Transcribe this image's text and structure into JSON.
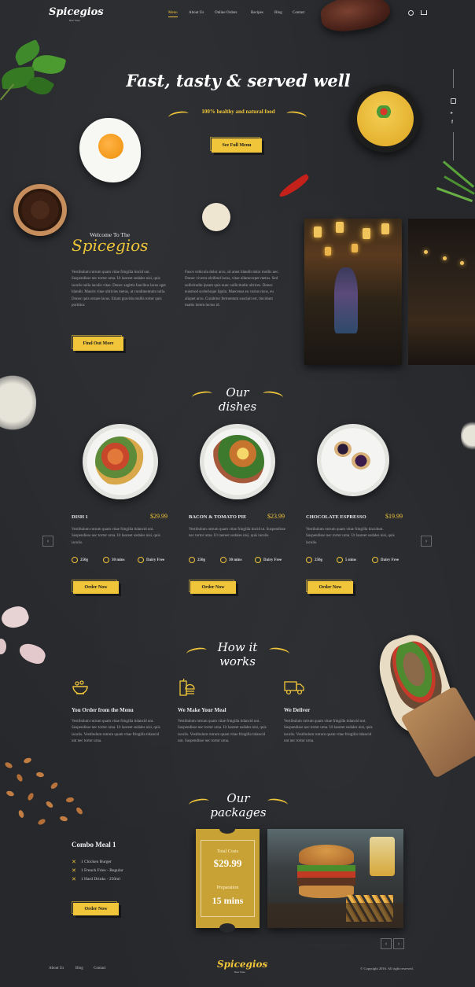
{
  "brand": {
    "logo": "Spicegios",
    "tagline": "Best Taste"
  },
  "nav": {
    "items": [
      {
        "label": "Menu",
        "active": true
      },
      {
        "label": "About Us"
      },
      {
        "label": "Online Orders"
      },
      {
        "label": "Recipes"
      },
      {
        "label": "Blog"
      },
      {
        "label": "Contact"
      }
    ]
  },
  "hero": {
    "title": "Fast, tasty & served well",
    "subtitle": "100% healthy and natural food",
    "cta": "See Full Menu"
  },
  "social": [
    "instagram-icon",
    "twitter-icon",
    "facebook-icon"
  ],
  "welcome": {
    "heading": "Welcome To The",
    "brand": "Spicegios",
    "text_left": "Vestibulum rutrum quam vitae fringilla tincid unt. Suspendisse nec tortor urna. Ut laoreet sodales nisi, quis iaculis nulla iaculis vitae. Donec sagittis faucibus lacus eget blandit. Mauris vitae ultricies metus, at condimentum nulla. Donec quis ornare lacus. Etiam gravida mollis tortor quis porttitor.",
    "text_right": "Fusce vehicula dolor arcu, sit amet blandit dolor mollis nec. Donec viverra eleifend lacus, vitae ullamcorper metus. Sed sollicitudin ipsum quis nunc sollicitudin ultrices. Donec euismod scelerisque ligula. Maecenas eu varius risus, eu aliquet arcu. Curabitur fermentum suscipit est, tincidunt mattis lorem luctus id.",
    "cta": "Find Out More"
  },
  "dishes": {
    "heading": "Our dishes",
    "items": [
      {
        "name": "DISH 1",
        "price": "$29.99",
        "desc": "Vestibulum rutrum quam vitae fringilla tidancid unt. Suspendisse nec tortor urna. Ut laoreet sodales nisi, quis iaculis.",
        "weight": "250g",
        "time": "30 mins",
        "tag": "Dairy Free",
        "cta": "Order Now"
      },
      {
        "name": "BACON & TOMATO PIE",
        "price": "$23.99",
        "desc": "Vestibulum rutrum quam vitae fringilla tincid ut. Suspendisse nec tortor urna. Ut laoreet sodales nisi, quis iaculis.",
        "weight": "250g",
        "time": "30 mins",
        "tag": "Dairy Free",
        "cta": "Order Now"
      },
      {
        "name": "CHOCOLATE ESPRESSO",
        "price": "$19.99",
        "desc": "Vestibulum rutrum quam vitae fringilla tincidunt. Suspendisse nec tortor urna. Ut laoreet sodales nisi, quis iaculis.",
        "weight": "250g",
        "time": "5 mins",
        "tag": "Dairy Free",
        "cta": "Order Now"
      }
    ],
    "prev": "‹",
    "next": "›"
  },
  "how": {
    "heading": "How it works",
    "steps": [
      {
        "title": "You Order from the Menu",
        "text": "Vestibulum rutrum quam vitae fringilla tidancid unt. Suspendisse nec tortor urna. Ut laoreet sodales nisi, quis iaculis. Vestibulum rutrum quam vitae fringilla tidancid unt nec tortor urna.",
        "icon": "food-bowl-icon"
      },
      {
        "title": "We Make Your Meal",
        "text": "Vestibulum rutrum quam vitae fringilla tidancid unt. Suspendisse nec tortor urna. Ut laoreet sodales nisi, quis iaculis. Vestibulum rutrum quam vitae fringilla tidancid unt. Suspendisse nec tortor urna.",
        "icon": "fast-food-icon"
      },
      {
        "title": "We Deliver",
        "text": "Vestibulum rutrum quam vitae fringilla tidancid unt. Suspendisse nec tortor urna. Ut laoreet sodales nisi, quis iaculis. Vestibulum rutrum quam vitae fringilla tidancid unt nec tortor urna.",
        "icon": "delivery-truck-icon"
      }
    ]
  },
  "packages": {
    "heading": "Our packages",
    "name": "Combo Meal 1",
    "items": [
      "1 Chicken Burger",
      "1 French Fries - Regular",
      "1 Hard Drinks - 250ml"
    ],
    "cta": "Order Now",
    "total_label": "Total Costs",
    "total": "$29.99",
    "prep_label": "Preparation",
    "prep": "15 mins",
    "prev": "‹",
    "next": "›"
  },
  "footer": {
    "links": [
      "About Us",
      "Blog",
      "Contact"
    ],
    "logo": "Spicegios",
    "tagline": "Best Taste",
    "copyright": "© Copyright 2016. All right reserved."
  },
  "colors": {
    "accent": "#f0c53a",
    "background": "#26282c"
  }
}
